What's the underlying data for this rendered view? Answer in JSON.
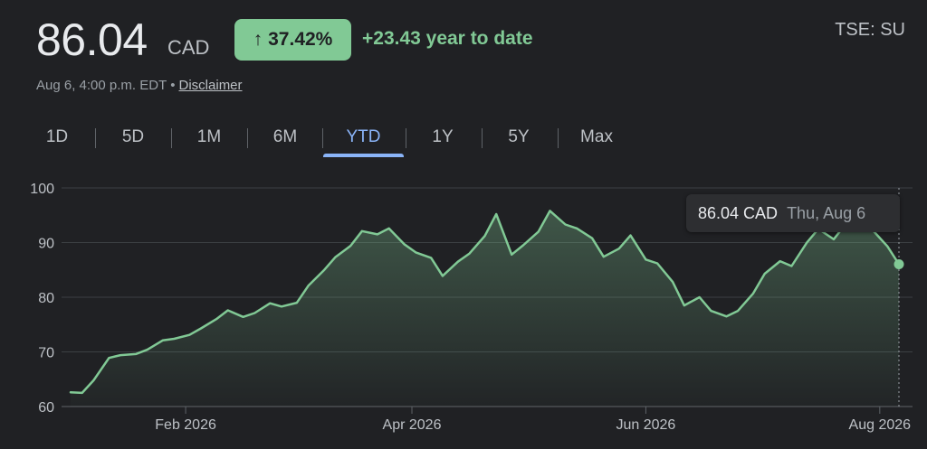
{
  "header": {
    "price": "86.04",
    "currency": "CAD",
    "change_arrow": "↑",
    "change_percent": "37.42%",
    "ytd_change": "+23.43 year to date",
    "ticker": "TSE: SU",
    "timestamp": "Aug 6, 4:00 p.m. EDT",
    "separator": "•",
    "disclaimer": "Disclaimer"
  },
  "tabs": [
    {
      "label": "1D"
    },
    {
      "label": "5D"
    },
    {
      "label": "1M"
    },
    {
      "label": "6M"
    },
    {
      "label": "YTD",
      "active": true
    },
    {
      "label": "1Y"
    },
    {
      "label": "5Y"
    },
    {
      "label": "Max"
    }
  ],
  "tooltip": {
    "price": "86.04 CAD",
    "date": "Thu, Aug 6"
  },
  "colors": {
    "background": "#202124",
    "line": "#81c995",
    "accent_blue": "#8ab4f8",
    "grid": "#3c4043",
    "text_secondary": "#bdc1c6"
  },
  "chart_data": {
    "type": "area",
    "title": "",
    "xlabel": "",
    "ylabel": "",
    "ylim": [
      60,
      100
    ],
    "yticks": [
      60,
      70,
      80,
      90,
      100
    ],
    "xticks": [
      "2026-02-01",
      "2026-04-01",
      "2026-06-01",
      "2026-08-01"
    ],
    "xtick_labels": [
      "Feb 2026",
      "Apr 2026",
      "Jun 2026",
      "Aug 2026"
    ],
    "xlim": [
      "2026-01-02",
      "2026-08-06"
    ],
    "grid": true,
    "series": [
      {
        "x": [
          "2026-01-02",
          "2026-01-05",
          "2026-01-08",
          "2026-01-12",
          "2026-01-15",
          "2026-01-19",
          "2026-01-22",
          "2026-01-26",
          "2026-01-29",
          "2026-02-02",
          "2026-02-05",
          "2026-02-09",
          "2026-02-12",
          "2026-02-16",
          "2026-02-19",
          "2026-02-23",
          "2026-02-26",
          "2026-03-02",
          "2026-03-05",
          "2026-03-09",
          "2026-03-12",
          "2026-03-16",
          "2026-03-19",
          "2026-03-23",
          "2026-03-26",
          "2026-03-30",
          "2026-04-02",
          "2026-04-06",
          "2026-04-09",
          "2026-04-13",
          "2026-04-16",
          "2026-04-20",
          "2026-04-23",
          "2026-04-27",
          "2026-04-30",
          "2026-05-04",
          "2026-05-07",
          "2026-05-11",
          "2026-05-14",
          "2026-05-18",
          "2026-05-21",
          "2026-05-25",
          "2026-05-28",
          "2026-06-01",
          "2026-06-04",
          "2026-06-08",
          "2026-06-11",
          "2026-06-15",
          "2026-06-18",
          "2026-06-22",
          "2026-06-25",
          "2026-06-29",
          "2026-07-02",
          "2026-07-06",
          "2026-07-09",
          "2026-07-13",
          "2026-07-16",
          "2026-07-20",
          "2026-07-23",
          "2026-07-27",
          "2026-07-30",
          "2026-08-03",
          "2026-08-06"
        ],
        "y": [
          62.6,
          62.5,
          64.8,
          68.9,
          69.4,
          69.6,
          70.4,
          72.1,
          72.4,
          73.1,
          74.3,
          76.0,
          77.6,
          76.4,
          77.1,
          78.9,
          78.3,
          79.0,
          82.1,
          84.9,
          87.3,
          89.4,
          92.1,
          91.5,
          92.6,
          89.7,
          88.2,
          87.2,
          83.9,
          86.5,
          88.0,
          91.2,
          95.2,
          87.8,
          89.5,
          92.0,
          95.8,
          93.3,
          92.6,
          90.8,
          87.4,
          88.9,
          91.3,
          86.9,
          86.2,
          82.8,
          78.5,
          80.0,
          77.5,
          76.5,
          77.5,
          80.7,
          84.3,
          86.6,
          85.7,
          90.0,
          92.5,
          90.6,
          93.3,
          95.3,
          92.4,
          89.3,
          86.04
        ]
      }
    ],
    "highlight": {
      "x": "2026-08-06",
      "y": 86.04
    }
  }
}
